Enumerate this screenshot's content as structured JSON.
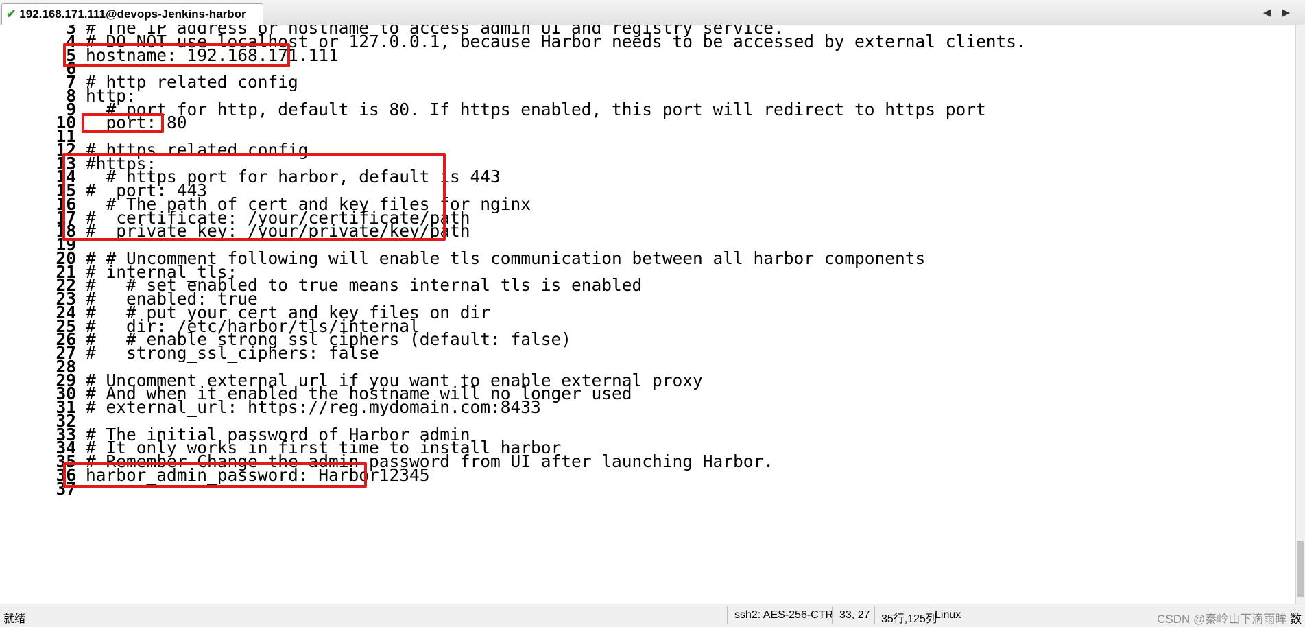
{
  "tab": {
    "title": "192.168.171.111@devops-Jenkins-harbor"
  },
  "nav": {
    "left": "◀",
    "right": "▶"
  },
  "lines": [
    {
      "n": "3",
      "text": "# The IP address or hostname to access admin UI and registry service."
    },
    {
      "n": "4",
      "text": "# DO NOT use localhost or 127.0.0.1, because Harbor needs to be accessed by external clients."
    },
    {
      "n": "5",
      "text": "hostname: 192.168.171.111"
    },
    {
      "n": "6",
      "text": ""
    },
    {
      "n": "7",
      "text": "# http related config"
    },
    {
      "n": "8",
      "text": "http:"
    },
    {
      "n": "9",
      "text": "  # port for http, default is 80. If https enabled, this port will redirect to https port"
    },
    {
      "n": "10",
      "text": "  port: 80"
    },
    {
      "n": "11",
      "text": ""
    },
    {
      "n": "12",
      "text": "# https related config"
    },
    {
      "n": "13",
      "text": "#https:"
    },
    {
      "n": "14",
      "text": "  # https port for harbor, default is 443"
    },
    {
      "n": "15",
      "text": "#  port: 443"
    },
    {
      "n": "16",
      "text": "  # The path of cert and key files for nginx"
    },
    {
      "n": "17",
      "text": "#  certificate: /your/certificate/path"
    },
    {
      "n": "18",
      "text": "#  private_key: /your/private/key/path"
    },
    {
      "n": "19",
      "text": ""
    },
    {
      "n": "20",
      "text": "# # Uncomment following will enable tls communication between all harbor components"
    },
    {
      "n": "21",
      "text": "# internal_tls:"
    },
    {
      "n": "22",
      "text": "#   # set enabled to true means internal tls is enabled"
    },
    {
      "n": "23",
      "text": "#   enabled: true"
    },
    {
      "n": "24",
      "text": "#   # put your cert and key files on dir"
    },
    {
      "n": "25",
      "text": "#   dir: /etc/harbor/tls/internal"
    },
    {
      "n": "26",
      "text": "#   # enable strong ssl ciphers (default: false)"
    },
    {
      "n": "27",
      "text": "#   strong_ssl_ciphers: false"
    },
    {
      "n": "28",
      "text": ""
    },
    {
      "n": "29",
      "text": "# Uncomment external_url if you want to enable external proxy"
    },
    {
      "n": "30",
      "text": "# And when it enabled the hostname will no longer used"
    },
    {
      "n": "31",
      "text": "# external_url: https://reg.mydomain.com:8433"
    },
    {
      "n": "32",
      "text": ""
    },
    {
      "n": "33",
      "text": "# The initial password of Harbor admin"
    },
    {
      "n": "34",
      "text": "# It only works in first time to install harbor"
    },
    {
      "n": "35",
      "text": "# Remember Change the admin password from UI after launching Harbor."
    },
    {
      "n": "36",
      "text": "harbor_admin_password: Harbor12345"
    },
    {
      "n": "37",
      "text": ""
    }
  ],
  "status": {
    "ready": "就绪",
    "cipher": "ssh2: AES-256-CTR",
    "cursor": "33,  27",
    "size": "35行,125列",
    "os": "Linux",
    "watermark": "CSDN @秦岭山下滴雨眸",
    "num": "数"
  },
  "colors": {
    "highlight": "#e11a1a",
    "check": "#2e9a2e"
  }
}
